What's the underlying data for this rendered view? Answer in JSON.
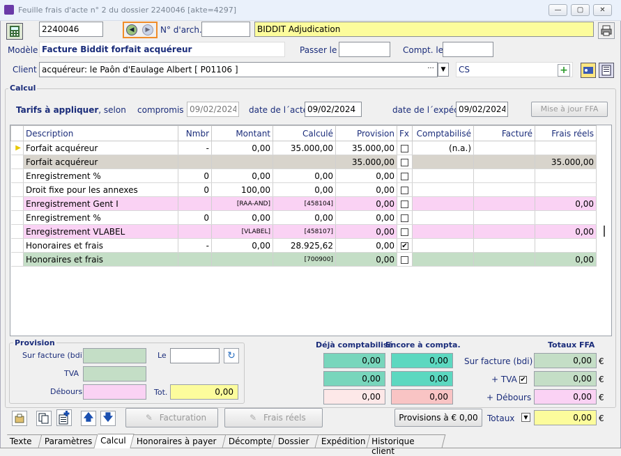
{
  "window": {
    "title": "Feuille frais d'acte n° 2 du dossier 2240046 [akte=4297]",
    "buttons": [
      "—",
      "▢",
      "✕"
    ]
  },
  "header": {
    "dossier_value": "2240046",
    "arch_label": "N° d'arch.",
    "arch_value": "",
    "name_value": "BIDDIT Adjudication",
    "modele_label": "Modèle",
    "modele_value": "Facture Biddit forfait acquéreur",
    "passer_label": "Passer le",
    "passer_value": "",
    "compt_label": "Compt. le",
    "compt_value": "",
    "client_label": "Client",
    "client_value": "acquéreur: le Paôn d'Eaulage Albert [ P01106 ]",
    "client_ellipsis": "···",
    "client_code": "CS"
  },
  "calcul": {
    "title": "Calcul",
    "tarifs_label": "Tarifs à appliquer",
    "tarifs_suffix": ", selon",
    "compromis_label": "compromis",
    "compromis_value": "09/02/2024",
    "date_acte_label": "date de l´acte",
    "date_acte_value": "09/02/2024",
    "date_exped_label": "date de l´expéd.",
    "date_exped_value": "09/02/2024",
    "update_button": "Mise à jour FFA"
  },
  "grid": {
    "columns": [
      "Description",
      "Nmbr",
      "Montant",
      "Calculé",
      "Provision",
      "Fx",
      "Comptabilisé",
      "Facturé",
      "Frais réels"
    ],
    "rows": [
      {
        "style": "white",
        "sel": "▶",
        "desc": "Forfait acquéreur",
        "nmbr": "-",
        "montant": "0,00",
        "calcule": "35.000,00",
        "provision": "35.000,00",
        "fx": "",
        "compta": "(n.a.)",
        "facture": "",
        "reels": ""
      },
      {
        "style": "gray",
        "sel": "",
        "desc": "Forfait acquéreur",
        "nmbr": "",
        "montant": "",
        "calcule": "",
        "provision": "35.000,00",
        "fx": "",
        "compta": "",
        "facture": "",
        "reels": "35.000,00"
      },
      {
        "style": "white",
        "sel": "",
        "desc": "Enregistrement %",
        "nmbr": "0",
        "montant": "0,00",
        "calcule": "0,00",
        "provision": "0,00",
        "fx": "",
        "compta": "",
        "facture": "",
        "reels": ""
      },
      {
        "style": "white",
        "sel": "",
        "desc": "Droit fixe pour les annexes",
        "nmbr": "0",
        "montant": "100,00",
        "calcule": "0,00",
        "provision": "0,00",
        "fx": "",
        "compta": "",
        "facture": "",
        "reels": ""
      },
      {
        "style": "pink",
        "sel": "",
        "desc": "Enregistrement Gent I",
        "nmbr": "",
        "montant": "[RAA-AND]",
        "calcule": "[458104]",
        "provision": "0,00",
        "fx": "",
        "compta": "",
        "facture": "",
        "reels": "0,00"
      },
      {
        "style": "white",
        "sel": "",
        "desc": "Enregistrement %",
        "nmbr": "0",
        "montant": "0,00",
        "calcule": "0,00",
        "provision": "0,00",
        "fx": "",
        "compta": "",
        "facture": "",
        "reels": ""
      },
      {
        "style": "pink",
        "sel": "",
        "desc": "Enregistrement VLABEL",
        "nmbr": "",
        "montant": "[VLABEL]",
        "calcule": "[458107]",
        "provision": "0,00",
        "fx": "",
        "compta": "",
        "facture": "",
        "reels": "0,00"
      },
      {
        "style": "white",
        "sel": "",
        "desc": "Honoraires et frais",
        "nmbr": "-",
        "montant": "0,00",
        "calcule": "28.925,62",
        "provision": "0,00",
        "fx": "✔",
        "compta": "",
        "facture": "",
        "reels": ""
      },
      {
        "style": "green",
        "sel": "",
        "desc": "Honoraires et frais",
        "nmbr": "",
        "montant": "",
        "calcule": "[700900]",
        "provision": "0,00",
        "fx": "",
        "compta": "",
        "facture": "",
        "reels": "0,00"
      }
    ]
  },
  "provision": {
    "title": "Provision",
    "sur_facture_label": "Sur facture (bdi)",
    "tva_label": "TVA",
    "debours_label": "Débours",
    "le_label": "Le",
    "le_value": "",
    "tot_label": "Tot.",
    "tot_value": "0,00"
  },
  "totals": {
    "deja_header": "Déjà comptabilisé",
    "encore_header": "Encore à compta.",
    "ffa_header": "Totaux FFA",
    "deja": [
      "0,00",
      "0,00",
      "0,00"
    ],
    "encore": [
      "0,00",
      "0,00",
      "0,00"
    ],
    "sur_facture_label": "Sur facture (bdi)",
    "tva_label": "+ TVA",
    "debours_label": "+ Débours",
    "totaux_label": "Totaux",
    "ffa": [
      "0,00",
      "0,00",
      "0,00",
      "0,00"
    ],
    "euro": "€"
  },
  "toolbar": {
    "facturation_label": "Facturation",
    "frais_reels_label": "Frais réels",
    "provisions_button": "Provisions à € 0,00"
  },
  "tabs": [
    "Texte",
    "Paramètres",
    "Calcul",
    "Honoraires à payer",
    "Décompte",
    "Dossier",
    "Expédition",
    "Historique client"
  ],
  "active_tab": "Calcul",
  "colors": {
    "yellow": "#fcfc9c",
    "green_field": "#c4dec6",
    "teal_field": "#78d6bc",
    "pink_field": "#fad2f4",
    "highlight_orange": "#f08c28"
  }
}
